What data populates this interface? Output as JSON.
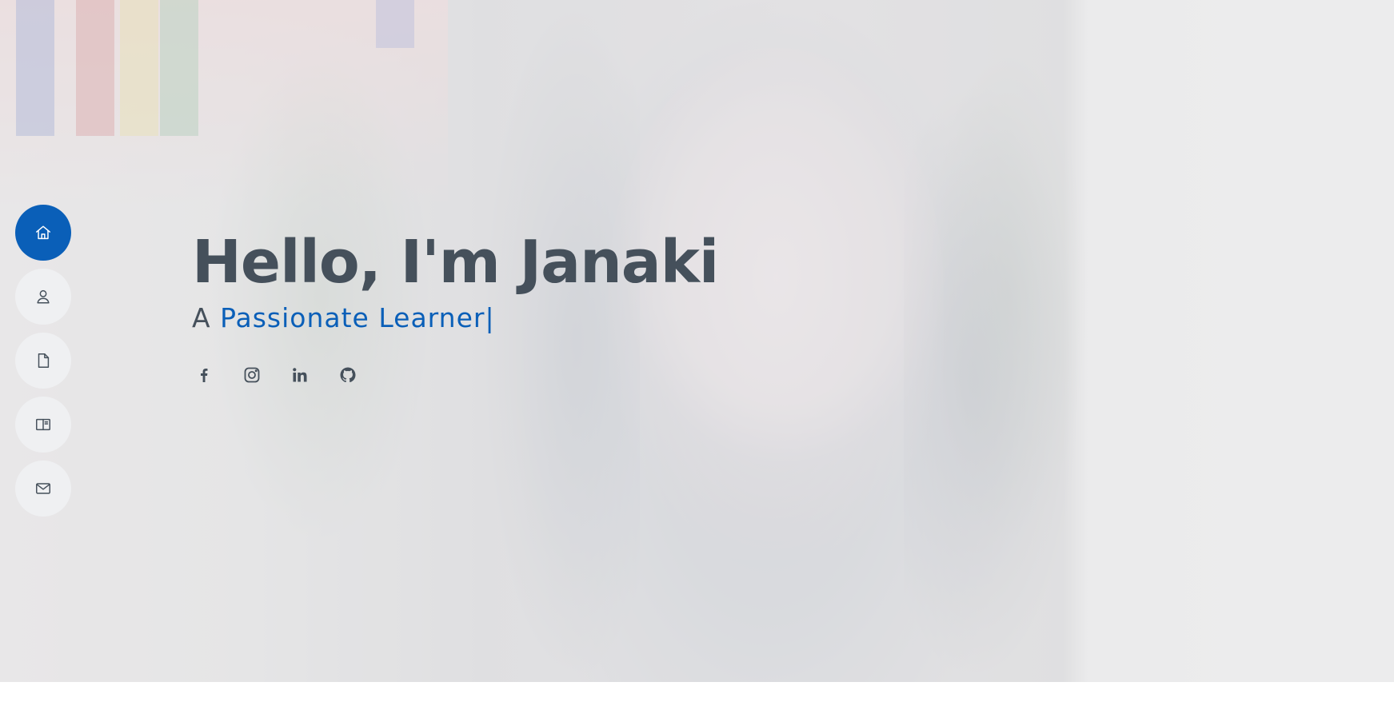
{
  "hero": {
    "greeting": "Hello, I'm Janaki",
    "subtitle_prefix": "A ",
    "typed_text": "Passionate Learner",
    "cursor": "|"
  },
  "side_nav": {
    "items": [
      {
        "icon": "home-icon",
        "active": true
      },
      {
        "icon": "person-icon",
        "active": false
      },
      {
        "icon": "file-icon",
        "active": false
      },
      {
        "icon": "book-icon",
        "active": false
      },
      {
        "icon": "envelope-icon",
        "active": false
      }
    ]
  },
  "social": {
    "links": [
      {
        "icon": "facebook-icon"
      },
      {
        "icon": "instagram-icon"
      },
      {
        "icon": "linkedin-icon"
      },
      {
        "icon": "github-icon"
      }
    ]
  },
  "colors": {
    "accent": "#0a5fb8",
    "text": "#45505b",
    "nav_bg": "#eff0f2",
    "page_bg": "#ffffff"
  }
}
